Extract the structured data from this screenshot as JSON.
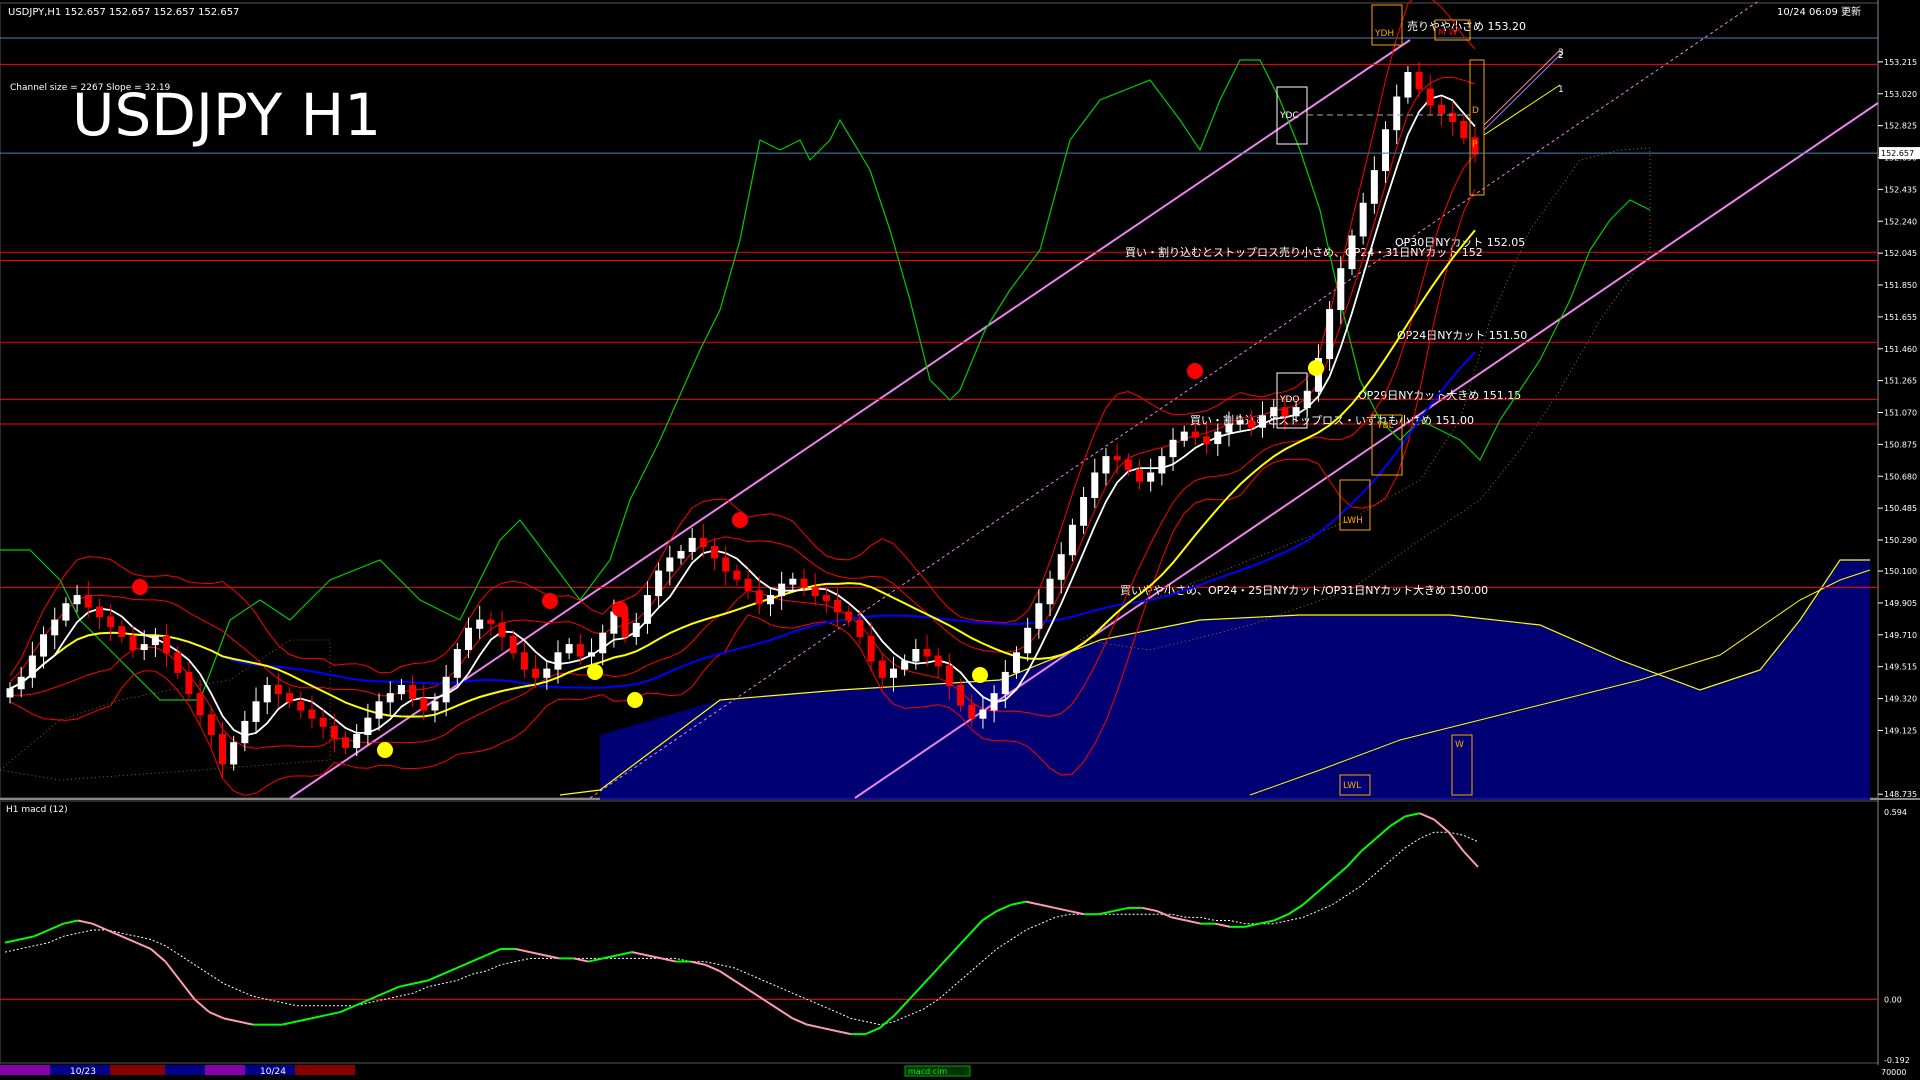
{
  "header": {
    "symbol_info": "USDJPY,H1  152.657 152.657 152.657 152.657",
    "timestamp": "10/24 06:09 更新",
    "channel_info": "Channel size = 2267  Slope = 32.19",
    "big_title": "USDJPY H1"
  },
  "colors": {
    "background": "#000000",
    "bull": "#ffffff",
    "bear": "#ff0000",
    "ma_fast": "#ffffff",
    "ma_mid": "#ffff00",
    "ma_slow": "#0000ff",
    "bollinger": "#ff0000",
    "chikou": "#00cc00",
    "channel": "#ee82ee",
    "level_line": "#ff0000",
    "cloud_top": "#ffff00",
    "cloud_fill": "#000088",
    "orange": "#ffa500",
    "macd_up": "#00ff00",
    "macd_down": "#ff9ab0",
    "signal": "#ffffff"
  },
  "price_axis": {
    "min": 148.73,
    "max": 153.41,
    "ticks": [
      "153.215",
      "153.020",
      "152.825",
      "152.630",
      "152.435",
      "152.240",
      "152.045",
      "151.850",
      "151.655",
      "151.460",
      "151.265",
      "151.070",
      "150.875",
      "150.680",
      "150.485",
      "150.290",
      "150.100",
      "149.905",
      "149.710",
      "149.515",
      "149.320",
      "149.125",
      "148.735"
    ],
    "current": "152.657"
  },
  "levels": [
    {
      "price": 153.2,
      "label": "売りやや小さめ 153.20"
    },
    {
      "price": 152.05,
      "label": "OP30日NYカット 152.05"
    },
    {
      "price": 152.0,
      "label": "買い・割り込むとストップロス売り小さめ、OP24・31日NYカット 152"
    },
    {
      "price": 151.5,
      "label": "OP24日NYカット 151.50"
    },
    {
      "price": 151.15,
      "label": "OP29日NYカット大きめ 151.15"
    },
    {
      "price": 151.0,
      "label": "買い・割り込むとストップロス・いずれも小さめ 151.00"
    },
    {
      "price": 150.0,
      "label": "買いやや小さめ、OP24・25日NYカット/OP31日NYカット大きめ 150.00"
    }
  ],
  "markers": {
    "ydh": "YDH",
    "ydc": "YDC",
    "ydo": "YDO",
    "ybl": "YBL",
    "lwh": "LWH",
    "lwl": "LWL",
    "d": "D",
    "w": "W",
    "p": "P",
    "m_w": "M W",
    "pivot_1": "1",
    "pivot_2": "2",
    "pivot_3": "3"
  },
  "macd_panel": {
    "title": "H1  macd (12)",
    "ticks": [
      "0.594",
      "0.00",
      "-0.192"
    ],
    "bottom_tag": "macd cim"
  },
  "time_axis": {
    "dates": [
      "10/23",
      "10/24"
    ],
    "right_value": "70000"
  },
  "chart_data": [
    {
      "type": "candlestick",
      "title": "USDJPY H1",
      "ylim": [
        148.73,
        153.41
      ],
      "close": [
        149.38,
        149.45,
        149.58,
        149.71,
        149.8,
        149.9,
        149.95,
        149.88,
        149.82,
        149.76,
        149.7,
        149.62,
        149.65,
        149.7,
        149.6,
        149.48,
        149.35,
        149.22,
        149.1,
        148.92,
        149.05,
        149.18,
        149.3,
        149.4,
        149.35,
        149.3,
        149.25,
        149.2,
        149.15,
        149.08,
        149.02,
        149.1,
        149.2,
        149.3,
        149.35,
        149.4,
        149.32,
        149.25,
        149.3,
        149.45,
        149.62,
        149.75,
        149.8,
        149.78,
        149.7,
        149.6,
        149.5,
        149.45,
        149.5,
        149.6,
        149.65,
        149.58,
        149.6,
        149.72,
        149.85,
        149.7,
        149.78,
        149.95,
        150.1,
        150.18,
        150.22,
        150.3,
        150.25,
        150.18,
        150.1,
        150.05,
        149.98,
        149.9,
        149.95,
        150.02,
        150.05,
        150.0,
        149.95,
        149.92,
        149.85,
        149.8,
        149.7,
        149.55,
        149.45,
        149.5,
        149.55,
        149.62,
        149.58,
        149.52,
        149.4,
        149.28,
        149.2,
        149.25,
        149.35,
        149.48,
        149.6,
        149.75,
        149.9,
        150.05,
        150.2,
        150.38,
        150.55,
        150.7,
        150.8,
        150.78,
        150.72,
        150.65,
        150.7,
        150.8,
        150.9,
        150.95,
        150.92,
        150.88,
        150.95,
        151.0,
        151.02,
        150.98,
        151.05,
        151.1,
        151.05,
        151.1,
        151.2,
        151.4,
        151.7,
        151.95,
        152.15,
        152.35,
        152.55,
        152.8,
        153.0,
        153.15,
        153.05,
        152.95,
        152.9,
        152.85,
        152.75,
        152.65
      ],
      "series": [
        {
          "name": "macd (12)",
          "values": [
            0.18,
            0.19,
            0.2,
            0.22,
            0.24,
            0.25,
            0.24,
            0.22,
            0.2,
            0.18,
            0.16,
            0.12,
            0.06,
            0.0,
            -0.04,
            -0.06,
            -0.07,
            -0.08,
            -0.08,
            -0.08,
            -0.07,
            -0.06,
            -0.05,
            -0.04,
            -0.02,
            0.0,
            0.02,
            0.04,
            0.05,
            0.06,
            0.08,
            0.1,
            0.12,
            0.14,
            0.16,
            0.16,
            0.15,
            0.14,
            0.13,
            0.13,
            0.12,
            0.13,
            0.14,
            0.15,
            0.14,
            0.13,
            0.12,
            0.12,
            0.11,
            0.09,
            0.06,
            0.03,
            0.0,
            -0.03,
            -0.06,
            -0.08,
            -0.09,
            -0.1,
            -0.11,
            -0.11,
            -0.09,
            -0.05,
            0.0,
            0.05,
            0.1,
            0.15,
            0.2,
            0.25,
            0.28,
            0.3,
            0.31,
            0.3,
            0.29,
            0.28,
            0.27,
            0.27,
            0.28,
            0.29,
            0.29,
            0.28,
            0.26,
            0.25,
            0.24,
            0.24,
            0.23,
            0.23,
            0.24,
            0.25,
            0.27,
            0.3,
            0.34,
            0.38,
            0.42,
            0.47,
            0.51,
            0.55,
            0.58,
            0.59,
            0.57,
            0.53,
            0.47,
            0.42
          ]
        },
        {
          "name": "signal",
          "values": [
            0.15,
            0.16,
            0.17,
            0.18,
            0.2,
            0.21,
            0.22,
            0.22,
            0.21,
            0.2,
            0.19,
            0.17,
            0.14,
            0.11,
            0.08,
            0.05,
            0.03,
            0.01,
            0.0,
            -0.01,
            -0.02,
            -0.02,
            -0.02,
            -0.02,
            -0.02,
            -0.01,
            0.0,
            0.01,
            0.02,
            0.04,
            0.05,
            0.06,
            0.08,
            0.09,
            0.11,
            0.12,
            0.13,
            0.13,
            0.13,
            0.13,
            0.13,
            0.13,
            0.13,
            0.13,
            0.13,
            0.13,
            0.13,
            0.12,
            0.12,
            0.11,
            0.1,
            0.08,
            0.06,
            0.04,
            0.02,
            0.0,
            -0.02,
            -0.04,
            -0.06,
            -0.07,
            -0.08,
            -0.07,
            -0.05,
            -0.03,
            0.0,
            0.04,
            0.08,
            0.12,
            0.16,
            0.19,
            0.22,
            0.24,
            0.26,
            0.27,
            0.27,
            0.27,
            0.27,
            0.27,
            0.27,
            0.27,
            0.27,
            0.26,
            0.26,
            0.25,
            0.25,
            0.24,
            0.24,
            0.24,
            0.25,
            0.26,
            0.28,
            0.3,
            0.33,
            0.36,
            0.4,
            0.44,
            0.48,
            0.51,
            0.53,
            0.53,
            0.52,
            0.5
          ]
        }
      ],
      "ylim_macd": [
        -0.192,
        0.594
      ]
    }
  ]
}
